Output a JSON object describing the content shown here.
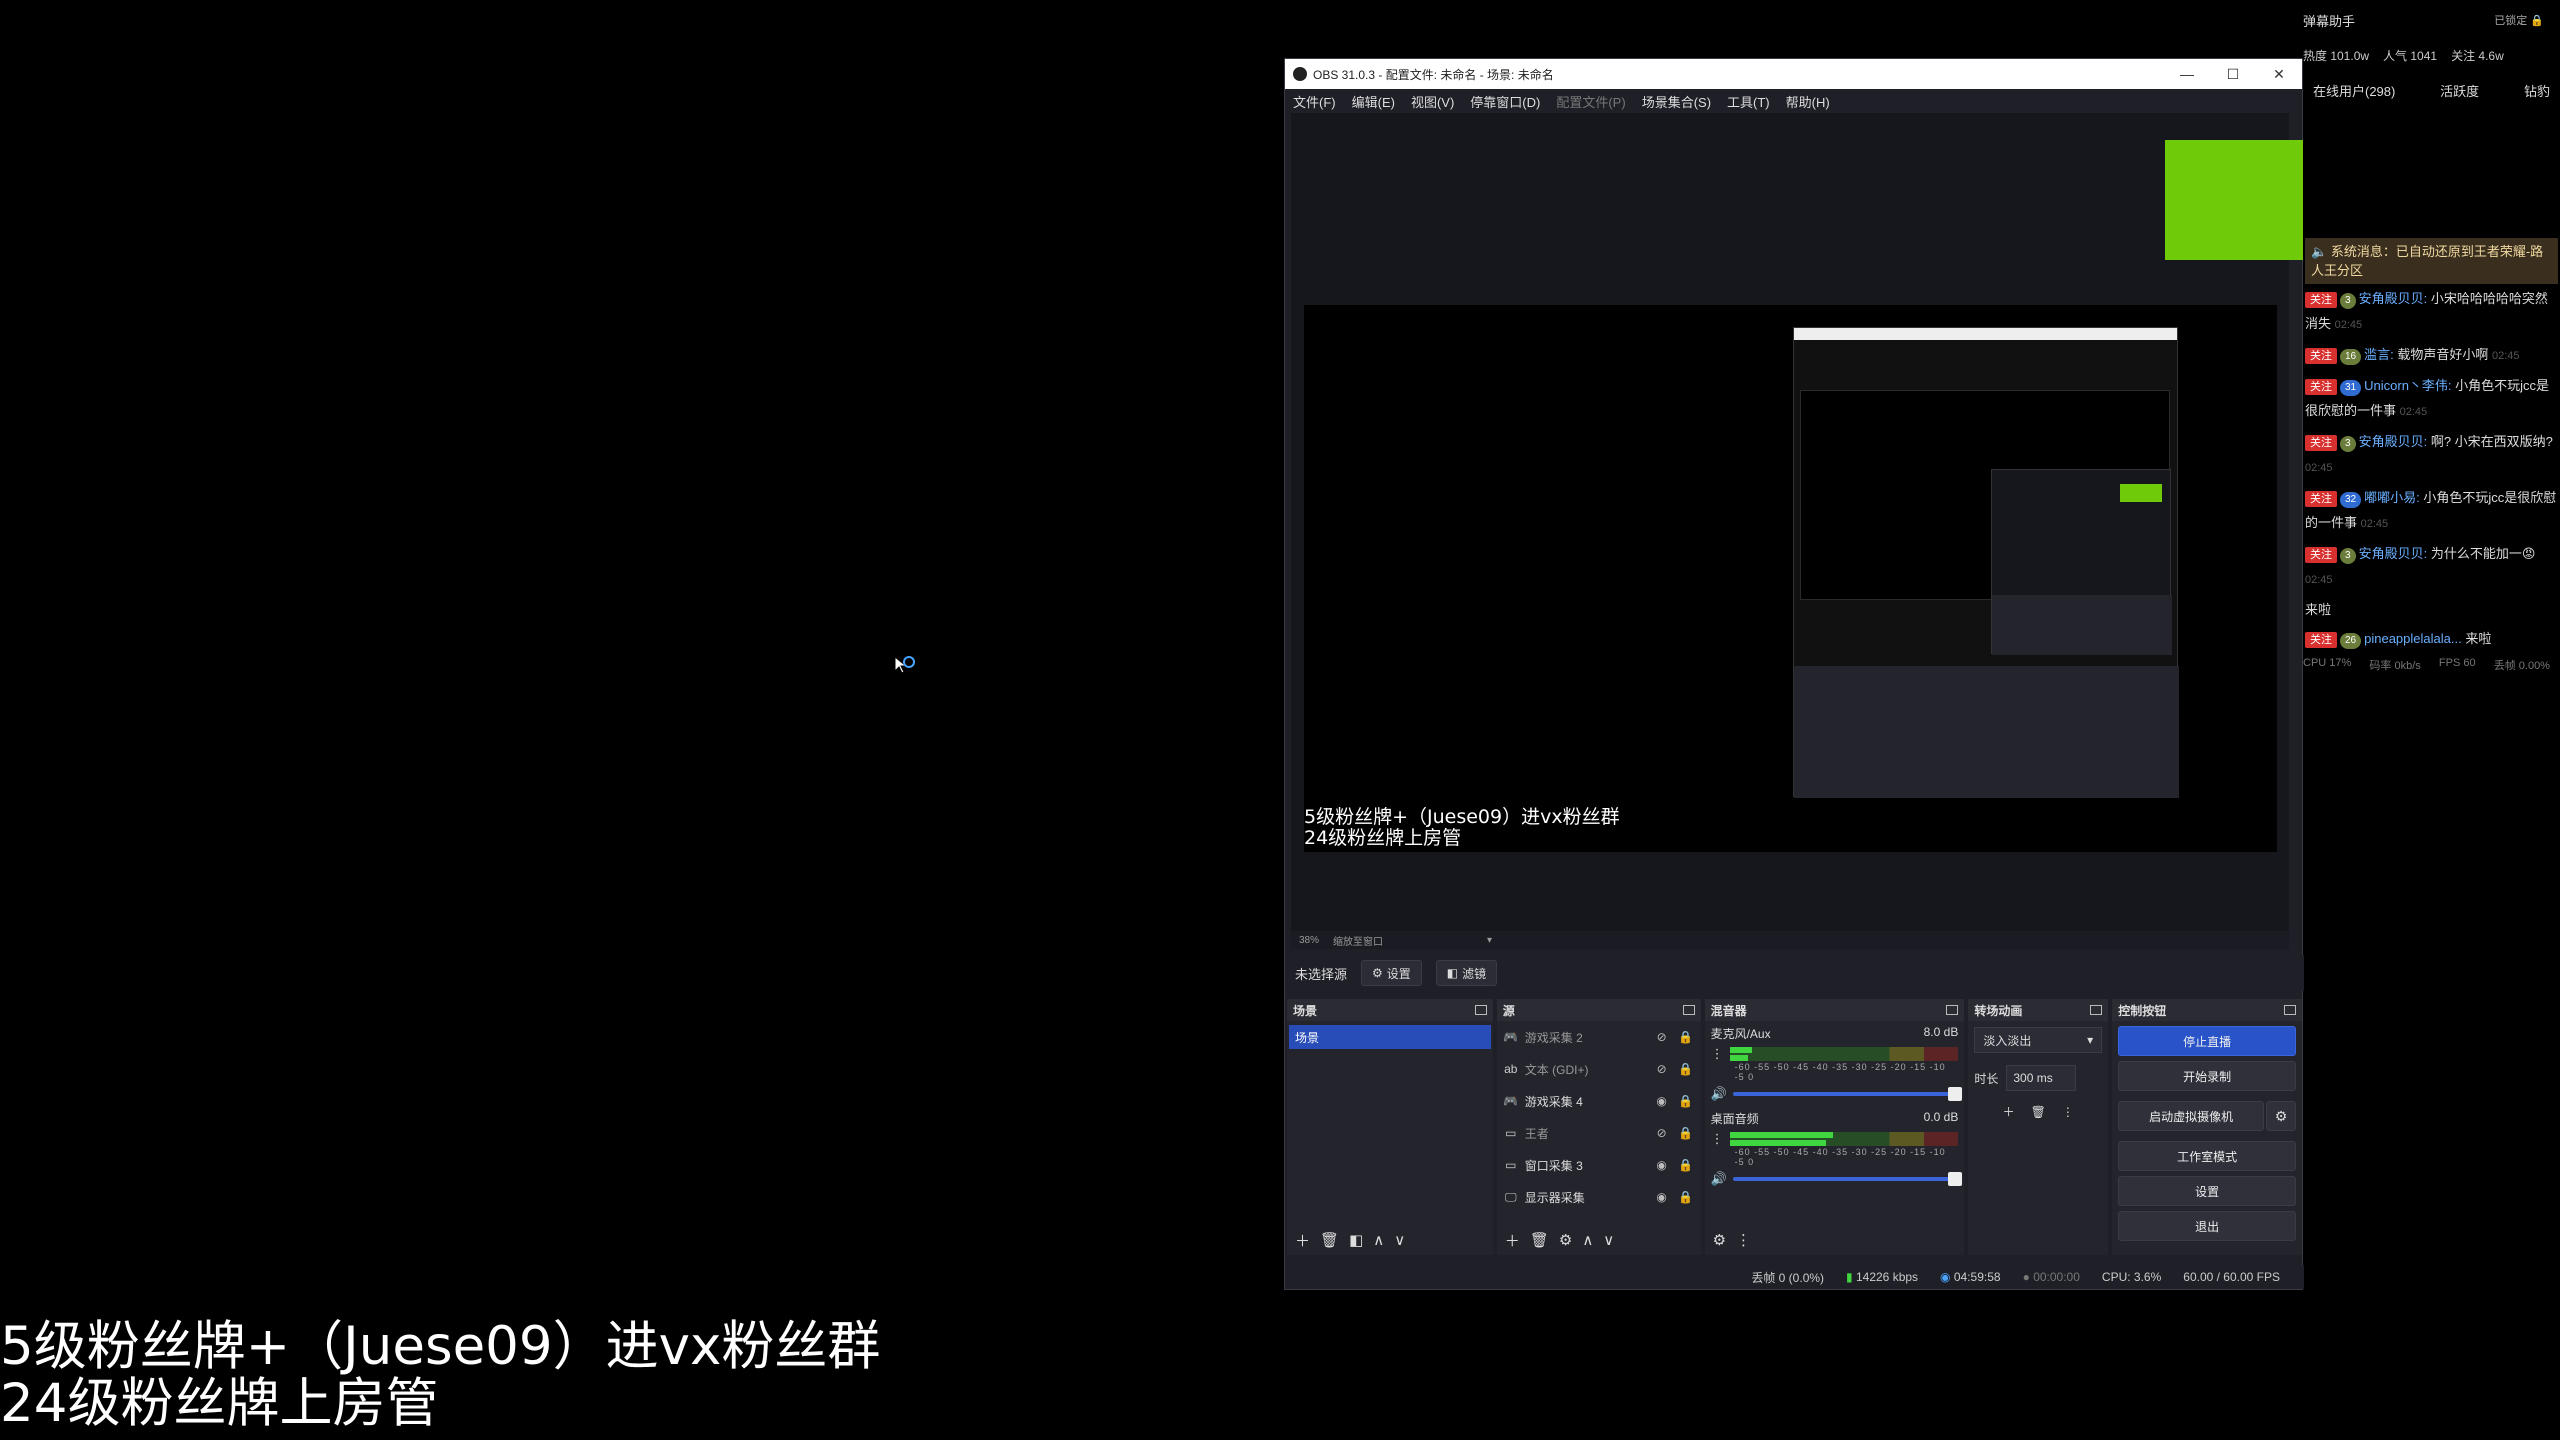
{
  "desktop": {
    "overlay_line1": "5级粉丝牌+（Juese09）进vx粉丝群",
    "overlay_line2": "24级粉丝牌上房管"
  },
  "obs": {
    "title": "OBS 31.0.3 - 配置文件: 未命名 - 场景: 未命名",
    "window_controls": {
      "minimize": "—",
      "maximize": "☐",
      "close": "✕"
    },
    "menu": [
      "文件(F)",
      "编辑(E)",
      "视图(V)",
      "停靠窗口(D)",
      "配置文件(P)",
      "场景集合(S)",
      "工具(T)",
      "帮助(H)"
    ],
    "preview_text1": "5级粉丝牌+（Juese09）进vx粉丝群",
    "preview_text2": "24级粉丝牌上房管",
    "zoom": "38%",
    "zoom_mode": "缩放至窗口",
    "no_source": "未选择源",
    "settings_btn": "设置",
    "filters_btn": "滤镜",
    "scenes": {
      "title": "场景",
      "items": [
        "场景"
      ]
    },
    "sources": {
      "title": "源",
      "items": [
        {
          "name": "游戏采集 2",
          "icon": "gamepad-icon",
          "visible": false
        },
        {
          "name": "文本 (GDI+)",
          "icon": "text-icon",
          "visible": false
        },
        {
          "name": "游戏采集 4",
          "icon": "gamepad-icon",
          "visible": true
        },
        {
          "name": "王者",
          "icon": "window-icon",
          "visible": false
        },
        {
          "name": "窗口采集 3",
          "icon": "window-icon",
          "visible": true
        },
        {
          "name": "显示器采集",
          "icon": "monitor-icon",
          "visible": true
        }
      ]
    },
    "mixer": {
      "title": "混音器",
      "tracks": [
        {
          "name": "麦克风/Aux",
          "db": "8.0 dB"
        },
        {
          "name": "桌面音频",
          "db": "0.0 dB"
        }
      ],
      "scale": "-60 -55 -50 -45 -40 -35 -30 -25 -20 -15 -10 -5 0"
    },
    "transitions": {
      "title": "转场动画",
      "type": "淡入淡出",
      "duration_label": "时长",
      "duration": "300 ms"
    },
    "controls": {
      "title": "控制按钮",
      "stop_stream": "停止直播",
      "start_record": "开始录制",
      "virtual_cam": "启动虚拟摄像机",
      "studio_mode": "工作室模式",
      "settings": "设置",
      "exit": "退出"
    },
    "status": {
      "dropped": "丢帧 0 (0.0%)",
      "bitrate": "14226 kbps",
      "stream_time": "04:59:58",
      "record_time": "00:00:00",
      "cpu": "CPU: 3.6%",
      "fps": "60.00 / 60.00 FPS"
    }
  },
  "danmu": {
    "title": "弹幕助手",
    "lock_state": "已锁定",
    "stats": [
      "热度 101.0w",
      "人气 1041",
      "关注 4.6w"
    ],
    "tabs": [
      "在线用户(298)",
      "活跃度",
      "钻豹"
    ],
    "system_msg": "系统消息：已自动还原到王者荣耀-路人王分区",
    "messages": [
      {
        "level": "3",
        "user": "安角殿贝贝:",
        "text": "小宋哈哈哈哈哈突然消失",
        "time": "02:45"
      },
      {
        "level": "16",
        "user": "滥言:",
        "text": "载物声音好小啊",
        "time": "02:45"
      },
      {
        "level": "31",
        "user": "Unicorn丶李伟:",
        "text": "小角色不玩jcc是很欣慰的一件事",
        "time": "02:45"
      },
      {
        "level": "3",
        "user": "安角殿贝贝:",
        "text": "啊? 小宋在西双版纳?",
        "time": "02:45"
      },
      {
        "level": "32",
        "user": "嘟嘟小易:",
        "text": "小角色不玩jcc是很欣慰的一件事",
        "time": "02:45"
      },
      {
        "level": "3",
        "user": "安角殿贝贝:",
        "text": "为什么不能加一😡",
        "time": "02:45"
      },
      {
        "level": "26",
        "user": "pineapplelalala...",
        "text": "来啦",
        "time": ""
      }
    ],
    "pre_msg": "来啦",
    "follow_tag": "关注",
    "footer": [
      "CPU 17%",
      "码率 0kb/s",
      "FPS 60",
      "丢帧 0.00%"
    ]
  }
}
